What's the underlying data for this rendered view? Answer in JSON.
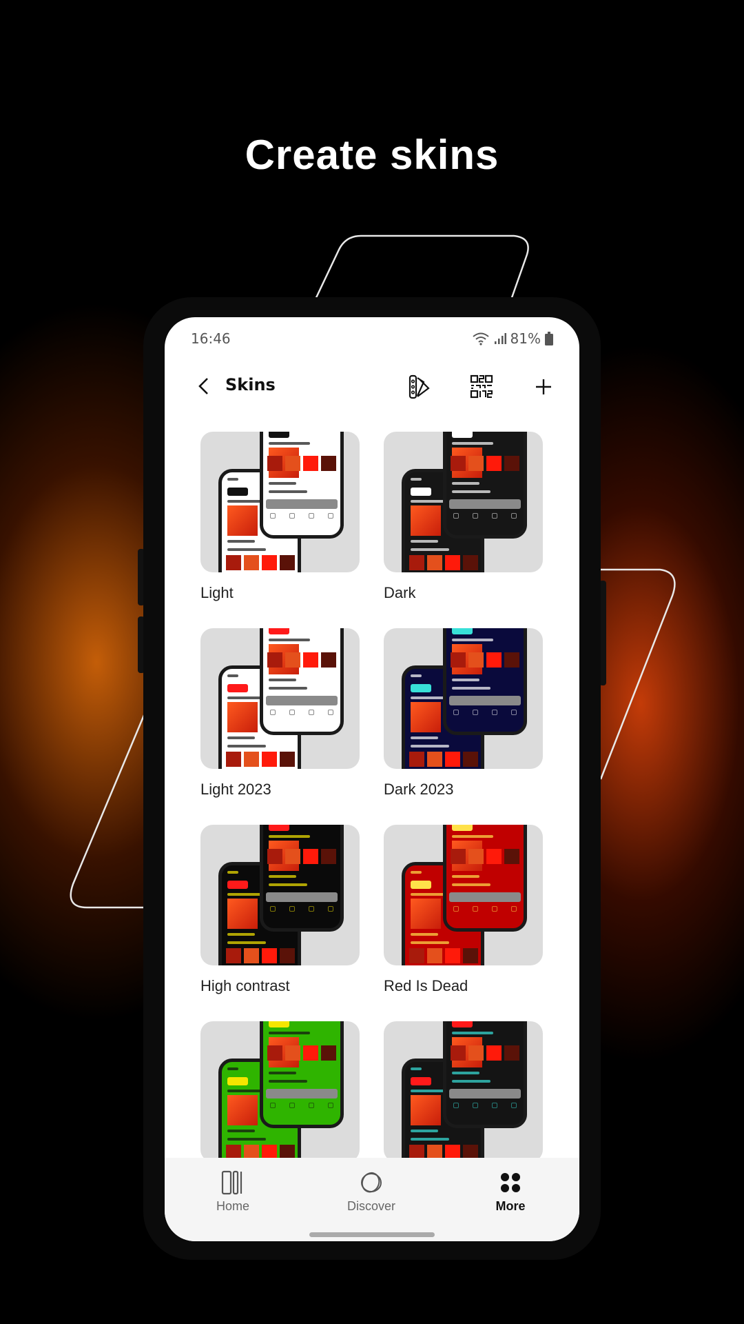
{
  "headline": "Create skins",
  "status": {
    "time": "16:46",
    "battery": "81%"
  },
  "header": {
    "title": "Skins",
    "icons": [
      "back-icon",
      "palette-swatch-icon",
      "qr-code-icon",
      "plus-icon"
    ]
  },
  "skins": [
    {
      "name": "Light",
      "screen": "#ffffff",
      "text": "#111111",
      "chip": "#111111"
    },
    {
      "name": "Dark",
      "screen": "#161616",
      "text": "#ffffff",
      "chip": "#ffffff"
    },
    {
      "name": "Light 2023",
      "screen": "#ffffff",
      "text": "#111111",
      "chip": "#ff1a1a"
    },
    {
      "name": "Dark 2023",
      "screen": "#0a0a3c",
      "text": "#ffffff",
      "chip": "#38e0d8"
    },
    {
      "name": "High contrast",
      "screen": "#0a0a0a",
      "text": "#f5e600",
      "chip": "#ff1a1a"
    },
    {
      "name": "Red Is Dead",
      "screen": "#c00000",
      "text": "#ffe14a",
      "chip": "#ffe14a"
    },
    {
      "name": "",
      "screen": "#2fb400",
      "text": "#111111",
      "chip": "#f5e600"
    },
    {
      "name": "",
      "screen": "#141414",
      "text": "#38e0d8",
      "chip": "#ff1a1a"
    }
  ],
  "nav": [
    {
      "label": "Home",
      "icon": "home-columns-icon",
      "active": false
    },
    {
      "label": "Discover",
      "icon": "discover-rings-icon",
      "active": false
    },
    {
      "label": "More",
      "icon": "grid-dots-icon",
      "active": true
    }
  ]
}
